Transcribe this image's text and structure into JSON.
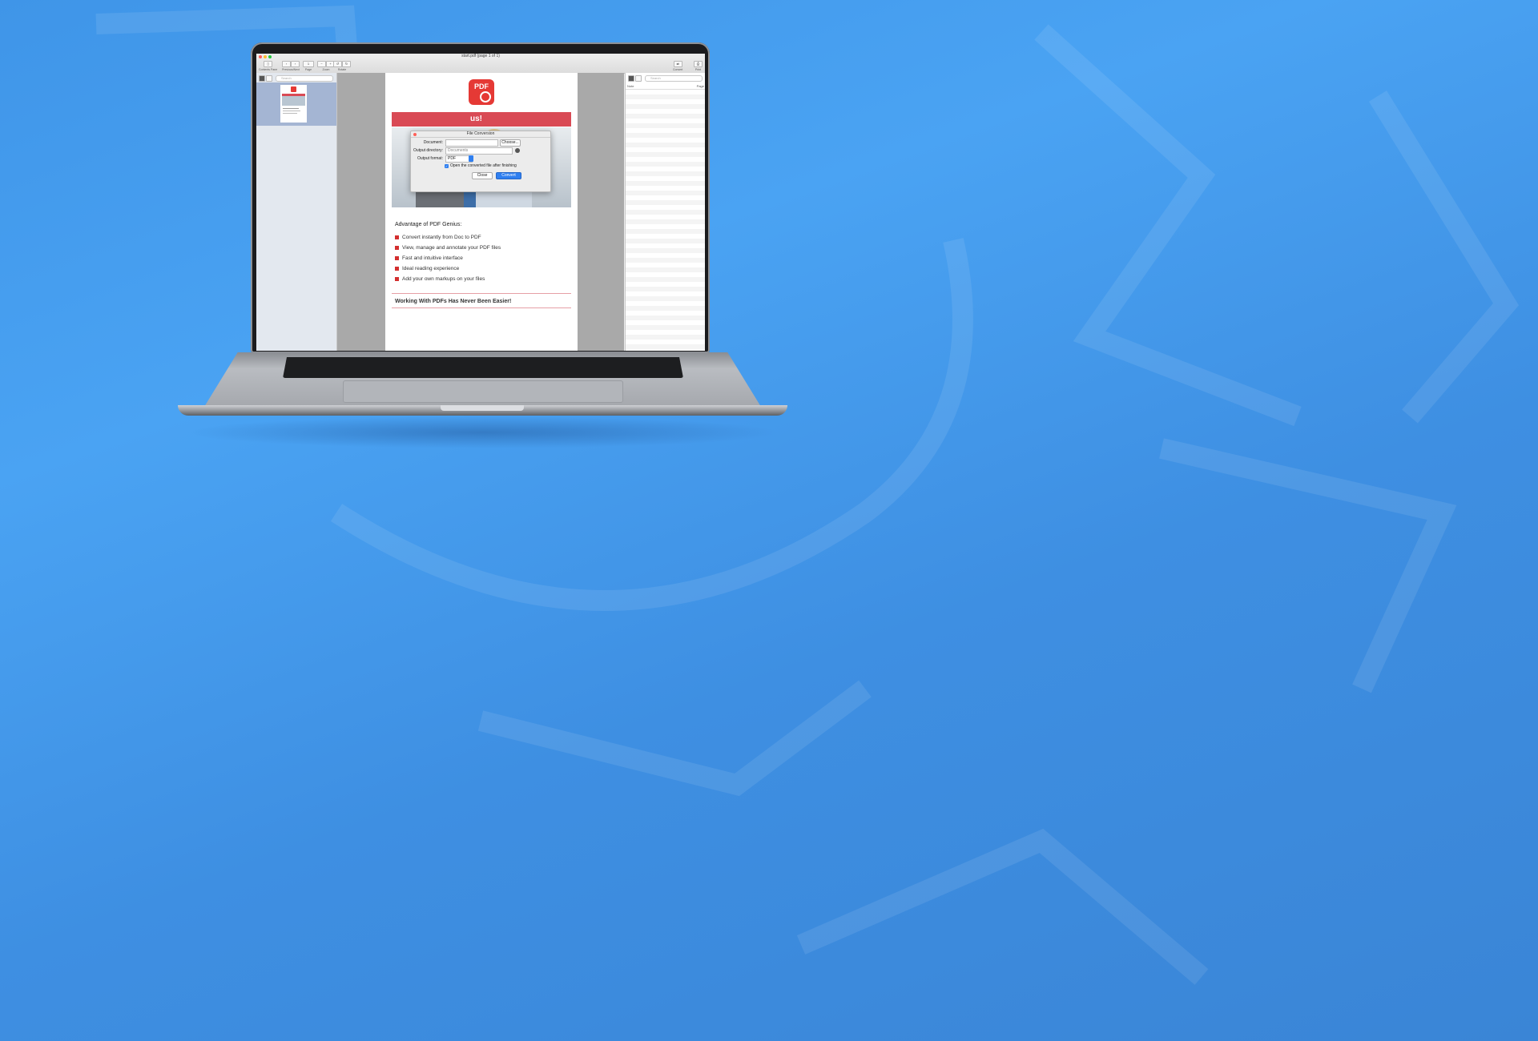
{
  "window": {
    "title": "start.pdf (page 1 of 1)"
  },
  "toolbar": {
    "contents_pane_label": "Contents Pane",
    "prev_next_label": "Previous/Next",
    "page_value": "1",
    "page_label": "Page",
    "zoom_label": "Zoom",
    "rotate_label": "Rotate",
    "convert_label": "Convert",
    "print_label": "Print"
  },
  "left_pane": {
    "search_placeholder": "Search"
  },
  "right_pane": {
    "search_placeholder": "Search",
    "col_note": "Note",
    "col_page": "Page"
  },
  "document": {
    "logo_text": "PDF",
    "banner_text": "us!",
    "advantage_title": "Advantage of PDF Genius:",
    "advantages": [
      "Convert instantly from Doc to PDF",
      "View, manage and annotate your PDF files",
      "Fast and intuitive interface",
      "Ideal reading experience",
      "Add your own markups on your files"
    ],
    "footer": "Working With PDFs Has Never Been Easier!"
  },
  "dialog": {
    "title": "File Conversion",
    "document_label": "Document:",
    "document_value": "",
    "choose_button": "Choose...",
    "output_dir_label": "Output directory:",
    "output_dir_value": "Documents",
    "output_format_label": "Output format:",
    "output_format_value": "PDF",
    "checkbox_label": "Open the converted file after finishing",
    "checkbox_checked": true,
    "close_button": "Close",
    "convert_button": "Convert"
  },
  "colors": {
    "accent": "#2f7ff0",
    "brand_red": "#e53935",
    "background_blue": "#4aa3f3"
  }
}
